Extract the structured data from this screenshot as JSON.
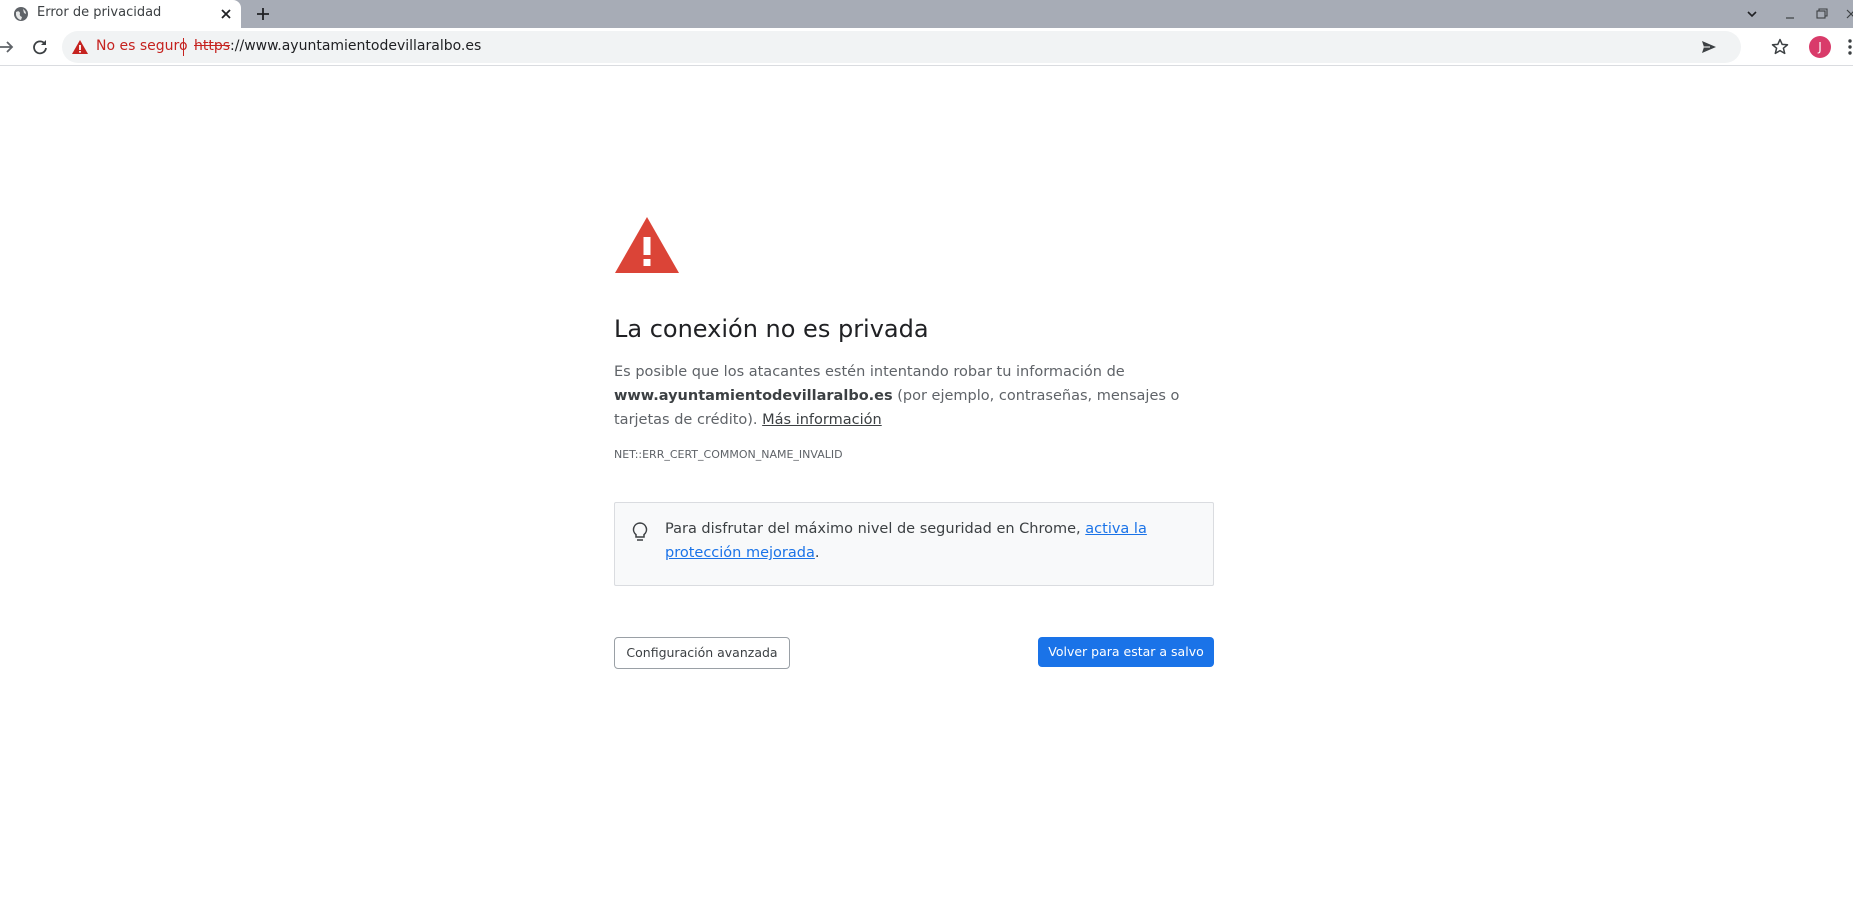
{
  "tab": {
    "title": "Error de privacidad",
    "favicon": "globe-icon"
  },
  "toolbar": {
    "security_label": "No es seguro",
    "url_scheme": "https",
    "url_rest": "://www.ayuntamientodevillaralbo.es",
    "avatar_initial": "J"
  },
  "interstitial": {
    "heading": "La conexión no es privada",
    "explanation_prefix": "Es posible que los atacantes estén intentando robar tu información de",
    "host": "www.ayuntamientodevillaralbo.es",
    "explanation_suffix": "(por ejemplo, contraseñas, mensajes o tarjetas de crédito).",
    "learn_more": "Más información",
    "error_code": "NET::ERR_CERT_COMMON_NAME_INVALID",
    "promo_text": "Para disfrutar del máximo nivel de seguridad en Chrome,",
    "promo_link": "activa la protección mejorada",
    "promo_end": ".",
    "advanced_button": "Configuración avanzada",
    "back_button": "Volver para estar a salvo"
  },
  "colors": {
    "danger": "#c5221f",
    "alert_icon": "#db4437",
    "primary": "#1a73e8",
    "tabstrip": "#a7acb6",
    "avatar": "#d93b6a"
  }
}
